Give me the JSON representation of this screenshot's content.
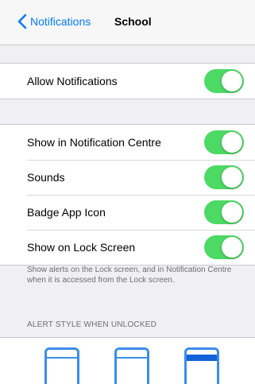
{
  "navbar": {
    "back_label": "Notifications",
    "title": "School"
  },
  "allow_group": {
    "rows": [
      {
        "label": "Allow Notifications",
        "toggle_on": true
      }
    ]
  },
  "settings_group": {
    "rows": [
      {
        "label": "Show in Notification Centre",
        "toggle_on": true
      },
      {
        "label": "Sounds",
        "toggle_on": true
      },
      {
        "label": "Badge App Icon",
        "toggle_on": true
      },
      {
        "label": "Show on Lock Screen",
        "toggle_on": true
      }
    ]
  },
  "lock_screen_note": "Show alerts on the Lock screen, and in Notification Centre when it is accessed from the Lock screen.",
  "alert_style_header": "ALERT STYLE WHEN UNLOCKED",
  "alert_styles": [
    {
      "icon": "alert-style-none-icon"
    },
    {
      "icon": "alert-style-none-icon"
    },
    {
      "icon": "alert-style-banner-icon"
    }
  ],
  "colors": {
    "accent": "#007aff",
    "toggle_on": "#4cd964",
    "background": "#efeff4",
    "secondary_text": "#6d6d72"
  }
}
